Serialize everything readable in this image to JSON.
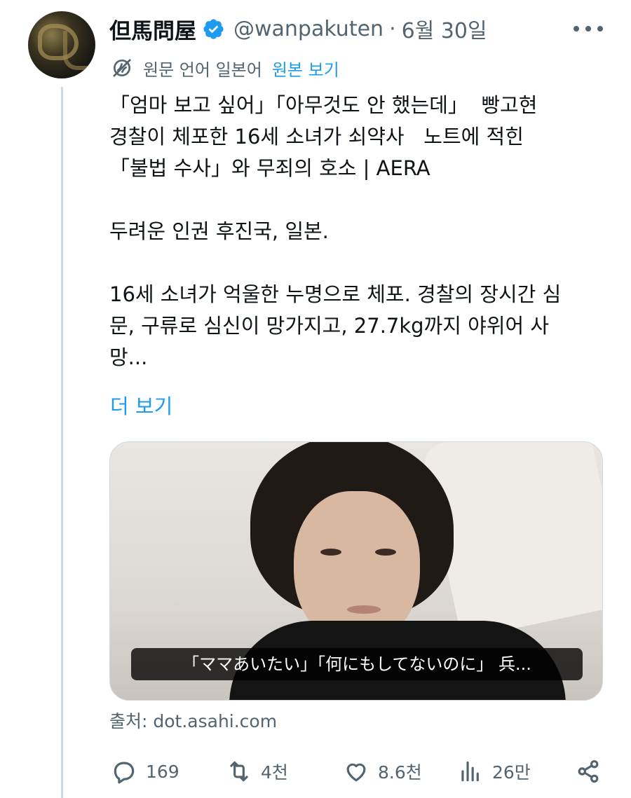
{
  "author": {
    "display_name": "但馬問屋",
    "handle": "@wanpakuten",
    "separator": "·",
    "date": "6월 30일"
  },
  "translation": {
    "label": "원문 언어 일본어",
    "link": "원본 보기"
  },
  "tweet": {
    "lines": [
      "「엄마 보고 싶어」「아무것도 안 했는데」  빵고현",
      "경찰이 체포한 16세 소녀가 쇠약사   노트에 적힌",
      "「불법 수사」와 무죄의 호소 | AERA",
      "",
      "두려운 인권 후진국, 일본.",
      "",
      "16세 소녀가 억울한 누명으로 체포. 경찰의 장시간 심",
      "문, 구류로 심신이 망가지고, 27.7kg까지 야위어 사",
      "망..."
    ],
    "show_more": "더 보기"
  },
  "media": {
    "caption": "「ママあいたい」「何にもしてないのに」 兵..."
  },
  "source": "출처: dot.asahi.com",
  "actions": {
    "reply_count": "169",
    "retweet_count": "4천",
    "like_count": "8.6천",
    "views_count": "26만"
  },
  "colors": {
    "accent": "#1d9bf0",
    "text": "#0f1419",
    "secondary": "#536471",
    "border": "#cfd9de"
  },
  "icons": [
    "verified-badge-icon",
    "more-options-icon",
    "translate-globe-icon",
    "reply-icon",
    "retweet-icon",
    "like-icon",
    "views-icon",
    "share-icon"
  ]
}
